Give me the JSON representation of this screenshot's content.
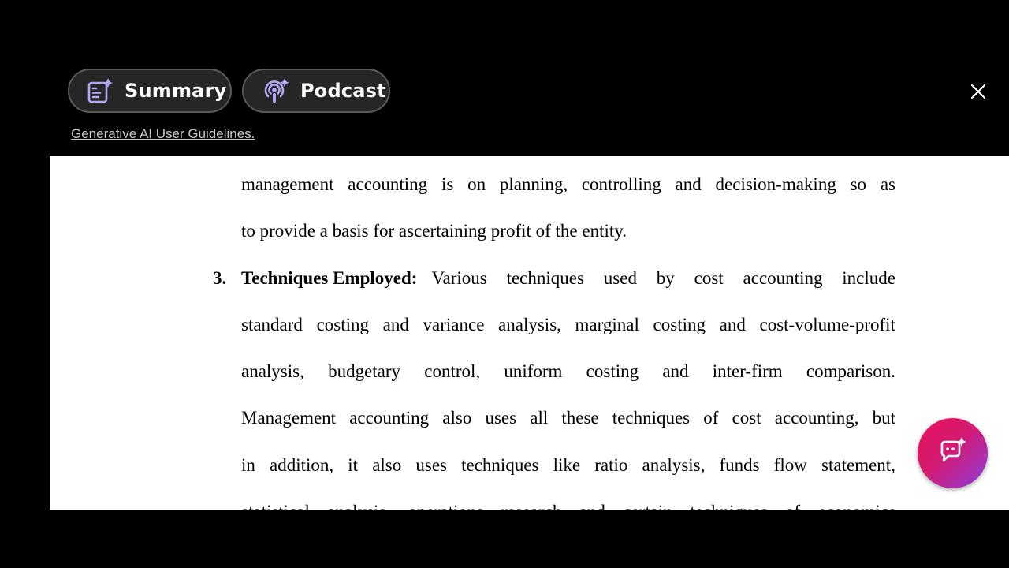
{
  "toolbar": {
    "summary_label": "Summary",
    "podcast_label": "Podcast",
    "guidelines_link": "Generative AI User Guidelines."
  },
  "icons": {
    "summary": "summary-sparkle-icon",
    "podcast": "podcast-sparkle-icon",
    "close": "close-icon",
    "assistant": "ai-chat-icon"
  },
  "colors": {
    "pill_background": "#262626",
    "pill_icon": "#b7a6f5",
    "fab_start": "#e8125a",
    "fab_end": "#8a3ee0"
  },
  "document": {
    "lines": [
      [
        "management",
        "accounting",
        "is",
        "on",
        "planning,",
        "controlling",
        "and",
        "decision-making",
        "so",
        "as"
      ],
      "to provide a basis for ascertaining profit of the entity.",
      [
        "Various",
        "techniques",
        "used",
        "by",
        "cost",
        "accounting",
        "include"
      ],
      [
        "standard",
        "costing",
        "and",
        "variance",
        "analysis,",
        "marginal",
        "costing",
        "and",
        "cost-volume-profit"
      ],
      [
        "analysis,",
        "budgetary",
        "control,",
        "uniform",
        "costing",
        "and",
        "inter-firm",
        "comparison."
      ],
      [
        "Management",
        "accounting",
        "also",
        "uses",
        "all",
        "these",
        "techniques",
        "of",
        "cost",
        "accounting,",
        "but"
      ],
      [
        "in",
        "addition,",
        "it",
        "also",
        "uses",
        "techniques",
        "like",
        "ratio",
        "analysis,",
        "funds",
        "flow",
        "statement,"
      ],
      [
        "statistical",
        "analysis,",
        "operations",
        "research",
        "and",
        "certain",
        "techniques",
        "of",
        "economics"
      ]
    ],
    "item_number": "3.",
    "item_heading": "Techniques Employed:"
  }
}
